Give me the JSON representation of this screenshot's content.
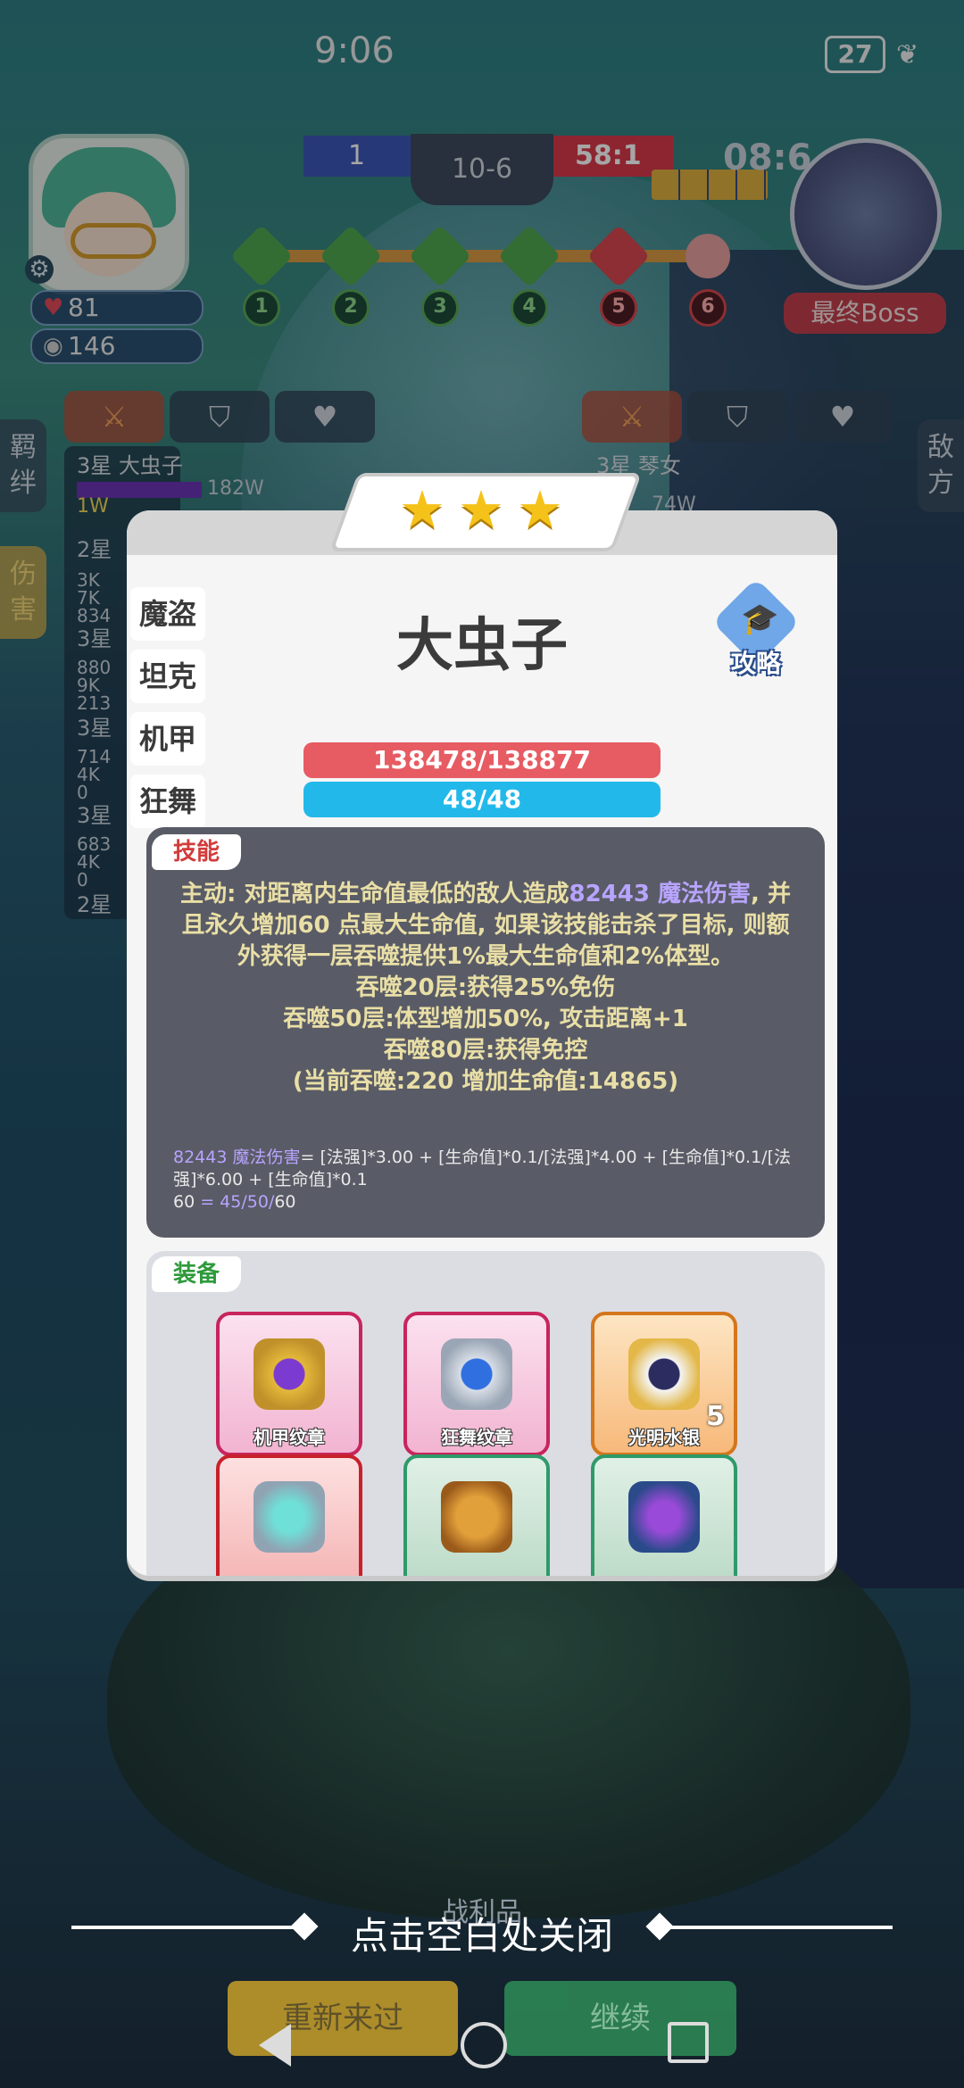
{
  "status_bar": {
    "time": "9:06",
    "battery": "27"
  },
  "hud": {
    "player_hp": "81",
    "player_gold": "146",
    "score_left": "1",
    "round": "10-6",
    "score_right": "58:1",
    "timer": "08:6",
    "boss_label": "最终Boss",
    "stages": [
      "1",
      "2",
      "3",
      "4",
      "5",
      "6"
    ]
  },
  "side_tabs": {
    "left_top": "羁绊",
    "left_active": "伤害",
    "right": "敌方"
  },
  "left_panel": {
    "top_hero": "3星 大虫子",
    "top_damage": "182W",
    "top_sub": "1W",
    "rows": [
      {
        "star": "2星",
        "vals": [
          "3K",
          "7K",
          "834"
        ]
      },
      {
        "star": "3星",
        "vals": [
          "880",
          "9K",
          "213"
        ]
      },
      {
        "star": "3星",
        "vals": [
          "714",
          "4K",
          "0"
        ]
      },
      {
        "star": "3星",
        "vals": [
          "683",
          "4K",
          "0"
        ]
      },
      {
        "star": "2星",
        "vals": []
      }
    ]
  },
  "right_panel": {
    "top_hero": "3星 琴女",
    "top_damage": "74W"
  },
  "modal": {
    "stars": 3,
    "classes": [
      "魔盗",
      "坦克",
      "机甲",
      "狂舞"
    ],
    "hero_name": "大虫子",
    "guide_label": "攻略",
    "hp": "138478/138877",
    "mana": "48/48",
    "skill_tag": "技能",
    "skill_desc_prefix": "主动: 对距离内生命值最低的敌人造成",
    "skill_damage": "82443 魔法伤害",
    "skill_desc_rest": ", 并且永久增加60 点最大生命值, 如果该技能击杀了目标, 则额外获得一层吞噬提供1%最大生命值和2%体型。",
    "skill_lines": [
      "吞噬20层:获得25%免伤",
      "吞噬50层:体型增加50%, 攻击距离+1",
      "吞噬80层:获得免控",
      "(当前吞噬:220 增加生命值:14865)"
    ],
    "formula_damage_label": "82443 魔法伤害",
    "formula_damage_expr": "= [法强]*3.00 + [生命值]*0.1/[法强]*4.00 + [生命值]*0.1/[法强]*6.00 + [生命值]*0.1",
    "formula_hp_label": "60",
    "formula_hp_expr": " = 45/50/",
    "formula_hp_value": "60",
    "equip_tag": "装备",
    "equipment": [
      {
        "name": "机甲纹章",
        "count": ""
      },
      {
        "name": "狂舞纹章",
        "count": ""
      },
      {
        "name": "光明水银",
        "count": "5"
      }
    ]
  },
  "bottom": {
    "close_hint": "点击空白处关闭",
    "spoils": "战利品",
    "retry": "重新来过",
    "continue": "继续"
  }
}
